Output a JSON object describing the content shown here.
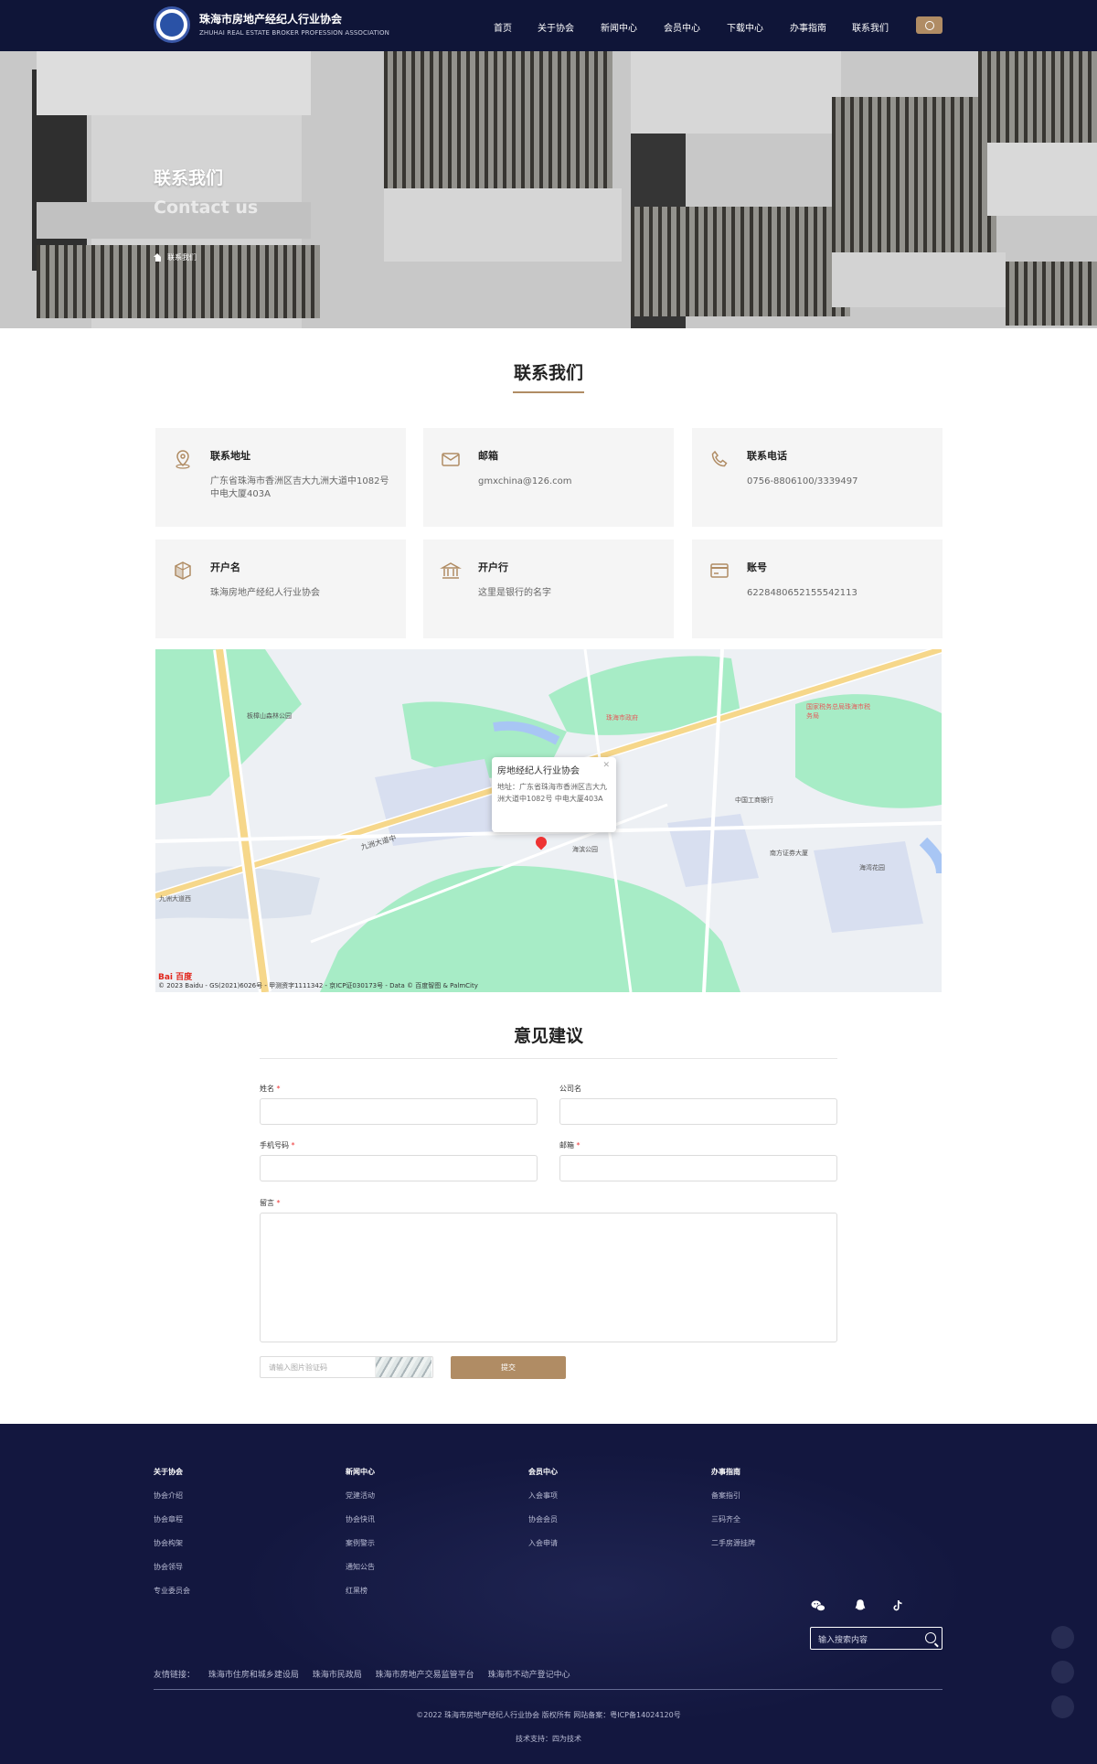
{
  "header": {
    "org_name": "珠海市房地产经纪人行业协会",
    "org_name_en": "ZHUHAI REAL ESTATE BROKER PROFESSION ASSOCIATION",
    "nav": [
      "首页",
      "关于协会",
      "新闻中心",
      "会员中心",
      "下载中心",
      "办事指南",
      "联系我们"
    ]
  },
  "banner": {
    "title": "联系我们",
    "subtitle": "Contact us",
    "breadcrumb": "联系我们"
  },
  "contact": {
    "section_title": "联系我们",
    "cards": [
      {
        "icon": "location-icon",
        "title": "联系地址",
        "value": "广东省珠海市香洲区吉大九洲大道中1082号 中电大厦403A"
      },
      {
        "icon": "mail-icon",
        "title": "邮箱",
        "value": "gmxchina@126.com"
      },
      {
        "icon": "phone-icon",
        "title": "联系电话",
        "value": "0756-8806100/3339497"
      },
      {
        "icon": "account-name-icon",
        "title": "开户名",
        "value": "珠海房地产经纪人行业协会"
      },
      {
        "icon": "bank-icon",
        "title": "开户行",
        "value": "这里是银行的名字"
      },
      {
        "icon": "card-icon",
        "title": "账号",
        "value": "6228480652155542113"
      }
    ]
  },
  "map": {
    "popup_title": "房地经纪人行业协会",
    "popup_address": "地址：广东省珠海市香洲区吉大九洲大道中1082号 中电大厦403A",
    "road_label": "九洲大道中",
    "copyright": "© 2023 Baidu - GS(2021)6026号 - 甲测资字1111342 - 京ICP证030173号 - Data © 百度智图 & PalmCity",
    "brand": "Bai 百度",
    "labels": [
      "板樟山森林公园",
      "珠海市政府",
      "国家税务总局珠海市税务局",
      "中国工商银行",
      "南方证券大厦",
      "海滨公园",
      "九洲大道西",
      "海湾花园"
    ]
  },
  "form": {
    "section_title": "意见建议",
    "name_label": "姓名",
    "company_label": "公司名",
    "phone_label": "手机号码",
    "email_label": "邮箱",
    "message_label": "留言",
    "required_mark": "*",
    "captcha_placeholder": "请输入图片验证码",
    "submit_label": "提交"
  },
  "footer": {
    "columns": [
      {
        "heading": "关于协会",
        "items": [
          "协会介绍",
          "协会章程",
          "协会构架",
          "协会领导",
          "专业委员会"
        ]
      },
      {
        "heading": "新闻中心",
        "items": [
          "党建活动",
          "协会快讯",
          "案例警示",
          "通知公告",
          "红黑榜"
        ]
      },
      {
        "heading": "会员中心",
        "items": [
          "入会事项",
          "协会会员",
          "入会申请"
        ]
      },
      {
        "heading": "办事指南",
        "items": [
          "备案指引",
          "三码齐全",
          "二手房源挂牌"
        ]
      }
    ],
    "search_placeholder": "输入搜索内容",
    "friend_links_label": "友情链接：",
    "friend_links": [
      "珠海市住房和城乡建设局",
      "珠海市民政局",
      "珠海市房地产交易监管平台",
      "珠海市不动产登记中心"
    ],
    "copyright": "©2022 珠海市房地产经纪人行业协会 版权所有 网站备案：粤ICP备14024120号",
    "tech_support": "技术支持：四为技术"
  }
}
